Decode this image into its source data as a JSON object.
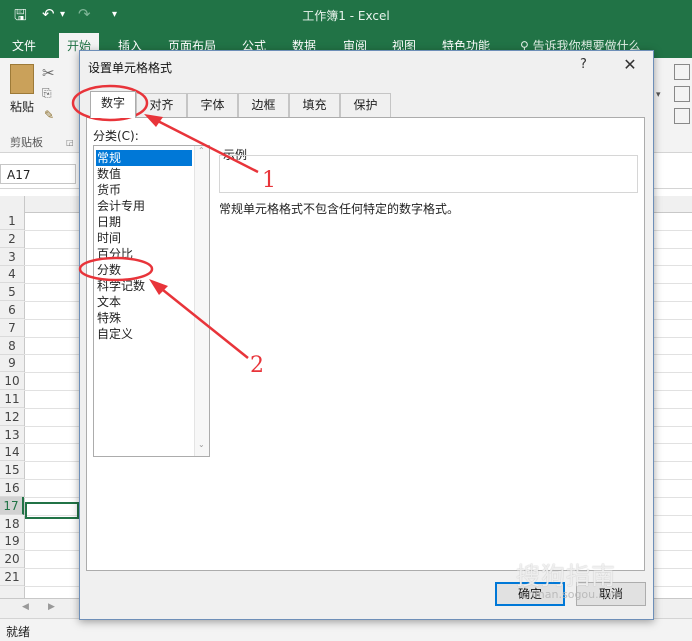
{
  "app": {
    "title": "工作簿1 - Excel",
    "tabs": [
      "文件",
      "开始",
      "插入",
      "页面布局",
      "公式",
      "数据",
      "审阅",
      "视图",
      "特色功能"
    ],
    "active_tab": "开始",
    "tell_me": "告诉我你想要做什么",
    "paste_label": "粘贴",
    "clipboard_group": "剪贴板",
    "name_box": "A17",
    "rows": [
      "1",
      "2",
      "3",
      "4",
      "5",
      "6",
      "7",
      "8",
      "9",
      "10",
      "11",
      "12",
      "13",
      "14",
      "15",
      "16",
      "17",
      "18",
      "19",
      "20",
      "21"
    ],
    "selected_row": "17",
    "status": "就绪"
  },
  "dialog": {
    "title": "设置单元格格式",
    "help": "?",
    "close": "✕",
    "tabs": [
      "数字",
      "对齐",
      "字体",
      "边框",
      "填充",
      "保护"
    ],
    "active_tab": "数字",
    "category_label": "分类(C):",
    "categories": [
      "常规",
      "数值",
      "货币",
      "会计专用",
      "日期",
      "时间",
      "百分比",
      "分数",
      "科学记数",
      "文本",
      "特殊",
      "自定义"
    ],
    "selected_category": "常规",
    "sample_label": "示例",
    "description": "常规单元格格式不包含任何特定的数字格式。",
    "ok": "确定",
    "cancel": "取消"
  },
  "annotations": {
    "label_1": "1",
    "label_2": "2",
    "color": "#e8343a"
  },
  "watermark": {
    "text": "搜狗指南",
    "url": "zhinan.sogou.com"
  }
}
